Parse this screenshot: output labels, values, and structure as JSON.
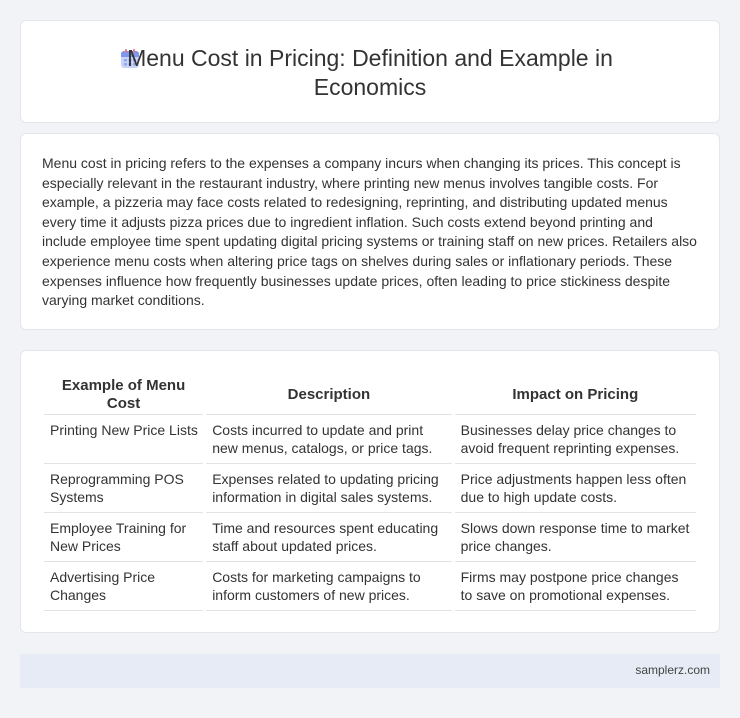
{
  "header": {
    "title": "Menu Cost in Pricing: Definition and Example in Economics",
    "icon": "calendar-icon"
  },
  "body": {
    "paragraph": "Menu cost in pricing refers to the expenses a company incurs when changing its prices. This concept is especially relevant in the restaurant industry, where printing new menus involves tangible costs. For example, a pizzeria may face costs related to redesigning, reprinting, and distributing updated menus every time it adjusts pizza prices due to ingredient inflation. Such costs extend beyond printing and include employee time spent updating digital pricing systems or training staff on new prices. Retailers also experience menu costs when altering price tags on shelves during sales or inflationary periods. These expenses influence how frequently businesses update prices, often leading to price stickiness despite varying market conditions."
  },
  "table": {
    "headers": [
      "Example of Menu Cost",
      "Description",
      "Impact on Pricing"
    ],
    "rows": [
      [
        "Printing New Price Lists",
        "Costs incurred to update and print new menus, catalogs, or price tags.",
        "Businesses delay price changes to avoid frequent reprinting expenses."
      ],
      [
        "Reprogramming POS Systems",
        "Expenses related to updating pricing information in digital sales systems.",
        "Price adjustments happen less often due to high update costs."
      ],
      [
        "Employee Training for New Prices",
        "Time and resources spent educating staff about updated prices.",
        "Slows down response time to market price changes."
      ],
      [
        "Advertising Price Changes",
        "Costs for marketing campaigns to inform customers of new prices.",
        "Firms may postpone price changes to save on promotional expenses."
      ]
    ]
  },
  "footer": {
    "site": "samplerz.com"
  }
}
